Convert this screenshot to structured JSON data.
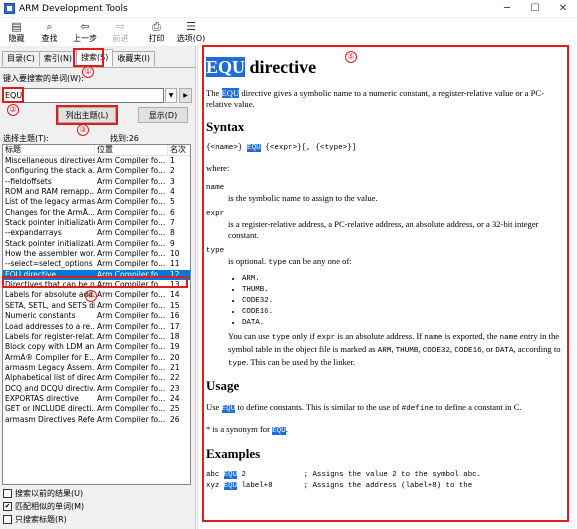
{
  "window": {
    "title": "ARM Development Tools",
    "minimize": "─",
    "maximize": "☐",
    "close": "✕"
  },
  "toolbar": [
    {
      "label": "隐藏",
      "icon": "▤",
      "enabled": true
    },
    {
      "label": "查找",
      "icon": "⌕",
      "enabled": true
    },
    {
      "label": "上一步",
      "icon": "⇦",
      "enabled": true
    },
    {
      "label": "前进",
      "icon": "⇨",
      "enabled": false
    },
    {
      "label": "打印",
      "icon": "⎙",
      "enabled": true
    },
    {
      "label": "选项(O)",
      "icon": "☰",
      "enabled": true
    }
  ],
  "tabs": [
    "目录(C)",
    "索引(N)",
    "搜索(S)",
    "收藏夹(I)"
  ],
  "search": {
    "keyword_label": "键入要搜索的单词(W):",
    "keyword_value": "EQU",
    "list_button": "列出主题(L)",
    "display_button": "显示(D)",
    "topic_label": "选择主题(T):",
    "found_text": "找到:26"
  },
  "columns": [
    "标题",
    "位置",
    "名次"
  ],
  "results": [
    [
      "Miscellaneous directives",
      "Arm Compiler fo...",
      "1"
    ],
    [
      "Configuring the stack a...",
      "Arm Compiler fo...",
      "2"
    ],
    [
      "--fieldoffsets",
      "Arm Compiler fo...",
      "3"
    ],
    [
      "ROM and RAM remapp...",
      "Arm Compiler fo...",
      "4"
    ],
    [
      "List of the legacy armas...",
      "Arm Compiler fo...",
      "5"
    ],
    [
      "Changes for the ArmÅ...",
      "Arm Compiler fo...",
      "6"
    ],
    [
      "Stack pointer initialization",
      "Arm Compiler fo...",
      "7"
    ],
    [
      "--expandarrays",
      "Arm Compiler fo...",
      "8"
    ],
    [
      "Stack pointer initializati...",
      "Arm Compiler fo...",
      "9"
    ],
    [
      "How the assembler wor...",
      "Arm Compiler fo...",
      "10"
    ],
    [
      "--select=select_options",
      "Arm Compiler fo...",
      "11"
    ],
    [
      "EQU directive",
      "Arm Compiler fo...",
      "12"
    ],
    [
      "Directives that can be o...",
      "Arm Compiler fo...",
      "13"
    ],
    [
      "Labels for absolute add...",
      "Arm Compiler fo...",
      "14"
    ],
    [
      "SETA, SETL, and SETS di...",
      "Arm Compiler fo...",
      "15"
    ],
    [
      "Numeric constants",
      "Arm Compiler fo...",
      "16"
    ],
    [
      "Load addresses to a re...",
      "Arm Compiler fo...",
      "17"
    ],
    [
      "Labels for register-relat...",
      "Arm Compiler fo...",
      "18"
    ],
    [
      "Block copy with LDM an...",
      "Arm Compiler fo...",
      "19"
    ],
    [
      "ArmÂ® Compiler for E...",
      "Arm Compiler fo...",
      "20"
    ],
    [
      "armasm Legacy Assem...",
      "Arm Compiler fo...",
      "21"
    ],
    [
      "Alphabetical list of direc...",
      "Arm Compiler fo...",
      "22"
    ],
    [
      "DCQ and DCQU directiv...",
      "Arm Compiler fo...",
      "23"
    ],
    [
      "EXPORTAS directive",
      "Arm Compiler fo...",
      "24"
    ],
    [
      "GET or INCLUDE directi...",
      "Arm Compiler fo...",
      "25"
    ],
    [
      "armasm Directives Refe...",
      "Arm Compiler fo...",
      "26"
    ]
  ],
  "selected_index": 11,
  "options": [
    {
      "label": "搜索以前的结果(U)",
      "checked": false
    },
    {
      "label": "匹配相似的单词(M)",
      "checked": true
    },
    {
      "label": "只搜索标题(R)",
      "checked": false
    }
  ],
  "doc": {
    "title_kw": "EQU",
    "title_rest": " directive",
    "intro_kw": "EQU",
    "intro_rest": " directive gives a symbolic name to a numeric constant, a register-relative value or a PC-relative value.",
    "the": "The ",
    "syntax_heading": "Syntax",
    "syntax_pre": "{<name>} ",
    "syntax_kw": "EQU",
    "syntax_post": " {<expr>}[, {<type>}]",
    "where": "where:",
    "param_name": "name",
    "param_name_desc": "is the symbolic name to assign to the value.",
    "param_expr": "expr",
    "param_expr_desc": "is a register-relative address, a PC-relative address, an absolute address, or a 32-bit integer constant.",
    "param_type": "type",
    "param_type_desc_pre": "is optional. ",
    "param_type_desc_code": "type",
    "param_type_desc_post": " can be any one of:",
    "types": [
      "ARM.",
      "THUMB.",
      "CODE32.",
      "CODE16.",
      "DATA."
    ],
    "usage_note_1": "You can use ",
    "usage_note_code1": "type",
    "usage_note_2": " only if ",
    "usage_note_code2": "expr",
    "usage_note_3": " is an absolute address. If ",
    "usage_note_code3": "name",
    "usage_note_4": " is exported, the ",
    "usage_note_code4": "name",
    "usage_note_5": " entry in the symbol table in the object file is marked as ",
    "usage_note_code5": "ARM",
    "usage_note_6": ", ",
    "usage_note_code6": "THUMB",
    "usage_note_7": ", ",
    "usage_note_code7": "CODE32",
    "usage_note_8": ", ",
    "usage_note_code8": "CODE16",
    "usage_note_9": ", or ",
    "usage_note_code9": "DATA",
    "usage_note_10": ", according to ",
    "usage_note_code10": "type",
    "usage_note_11": ". This can be used by the linker.",
    "usage_heading": "Usage",
    "usage_1": "Use ",
    "usage_kw": "EQU",
    "usage_2": " to define constants. This is similar to the use of ",
    "usage_code": "#define",
    "usage_3": " to define a constant in C.",
    "synonym_1": "* is a synonym for ",
    "synonym_kw": "EQU",
    "synonym_2": ".",
    "examples_heading": "Examples",
    "ex1_pre": "abc ",
    "ex1_kw": "EQU",
    "ex1_post": " 2             ; Assigns the value 2 to the symbol abc.",
    "ex2_pre": "xyz ",
    "ex2_kw": "EQU",
    "ex2_post": " label+8       ; Assigns the address (label+8) to the"
  },
  "annotations": [
    "①",
    "②",
    "③",
    "④",
    "⑤"
  ]
}
